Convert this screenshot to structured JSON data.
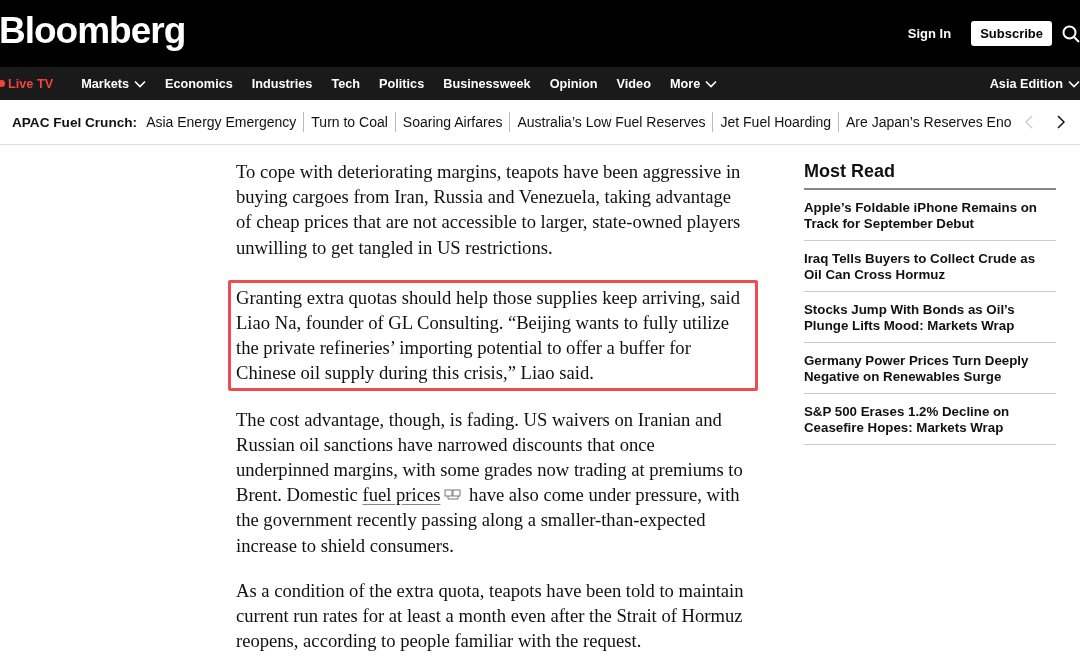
{
  "header": {
    "logo": "Bloomberg",
    "sign_in": "Sign In",
    "subscribe": "Subscribe"
  },
  "nav": {
    "live": "Live TV",
    "items": [
      {
        "label": "Markets",
        "dropdown": true
      },
      {
        "label": "Economics",
        "dropdown": false
      },
      {
        "label": "Industries",
        "dropdown": false
      },
      {
        "label": "Tech",
        "dropdown": false
      },
      {
        "label": "Politics",
        "dropdown": false
      },
      {
        "label": "Businessweek",
        "dropdown": false
      },
      {
        "label": "Opinion",
        "dropdown": false
      },
      {
        "label": "Video",
        "dropdown": false
      },
      {
        "label": "More",
        "dropdown": true
      }
    ],
    "edition": {
      "label": "Asia Edition",
      "dropdown": true
    }
  },
  "topics": {
    "label": "APAC Fuel Crunch:",
    "items": [
      "Asia Energy Emergency",
      "Turn to Coal",
      "Soaring Airfares",
      "Australia’s Low Fuel Reserves",
      "Jet Fuel Hoarding",
      "Are Japan’s Reserves Eno"
    ],
    "prev_disabled": true
  },
  "article": {
    "paragraphs": [
      {
        "highlighted": false,
        "segments": [
          {
            "kind": "text",
            "text": "To cope with deteriorating margins, teapots have been aggressive in buying cargoes from Iran, Russia and Venezuela, taking advantage of cheap prices that are not accessible to larger, state-owned players unwilling to get tangled in US restrictions."
          }
        ]
      },
      {
        "highlighted": true,
        "segments": [
          {
            "kind": "text",
            "text": "Granting extra quotas should help those supplies keep arriving, said Liao Na, founder of GL Consulting. “Beijing wants to fully utilize the private refineries’ importing potential to offer a buffer for Chinese oil supply during this crisis,” Liao said."
          }
        ]
      },
      {
        "highlighted": false,
        "segments": [
          {
            "kind": "text",
            "text": "The cost advantage, though, is fading. US waivers on Iranian and Russian oil sanctions have narrowed discounts that once underpinned margins, with some grades now trading at premiums to Brent. Domestic "
          },
          {
            "kind": "link",
            "text": "fuel prices"
          },
          {
            "kind": "text",
            "text": " have also come under pressure, with the government recently passing along a smaller-than-expected increase to shield consumers."
          }
        ]
      },
      {
        "highlighted": false,
        "segments": [
          {
            "kind": "text",
            "text": "As a condition of the extra quota, teapots have been told to maintain current run rates for at least a month even after the Strait of Hormuz reopens, according to people familiar with the request."
          }
        ]
      }
    ]
  },
  "most_read": {
    "title": "Most Read",
    "items": [
      "Apple’s Foldable iPhone Remains on Track for September Debut",
      "Iraq Tells Buyers to Collect Crude as Oil Can Cross Hormuz",
      "Stocks Jump With Bonds as Oil’s Plunge Lifts Mood: Markets Wrap",
      "Germany Power Prices Turn Deeply Negative on Renewables Surge",
      "S&P 500 Erases 1.2% Decline on Ceasefire Hopes: Markets Wrap"
    ]
  }
}
